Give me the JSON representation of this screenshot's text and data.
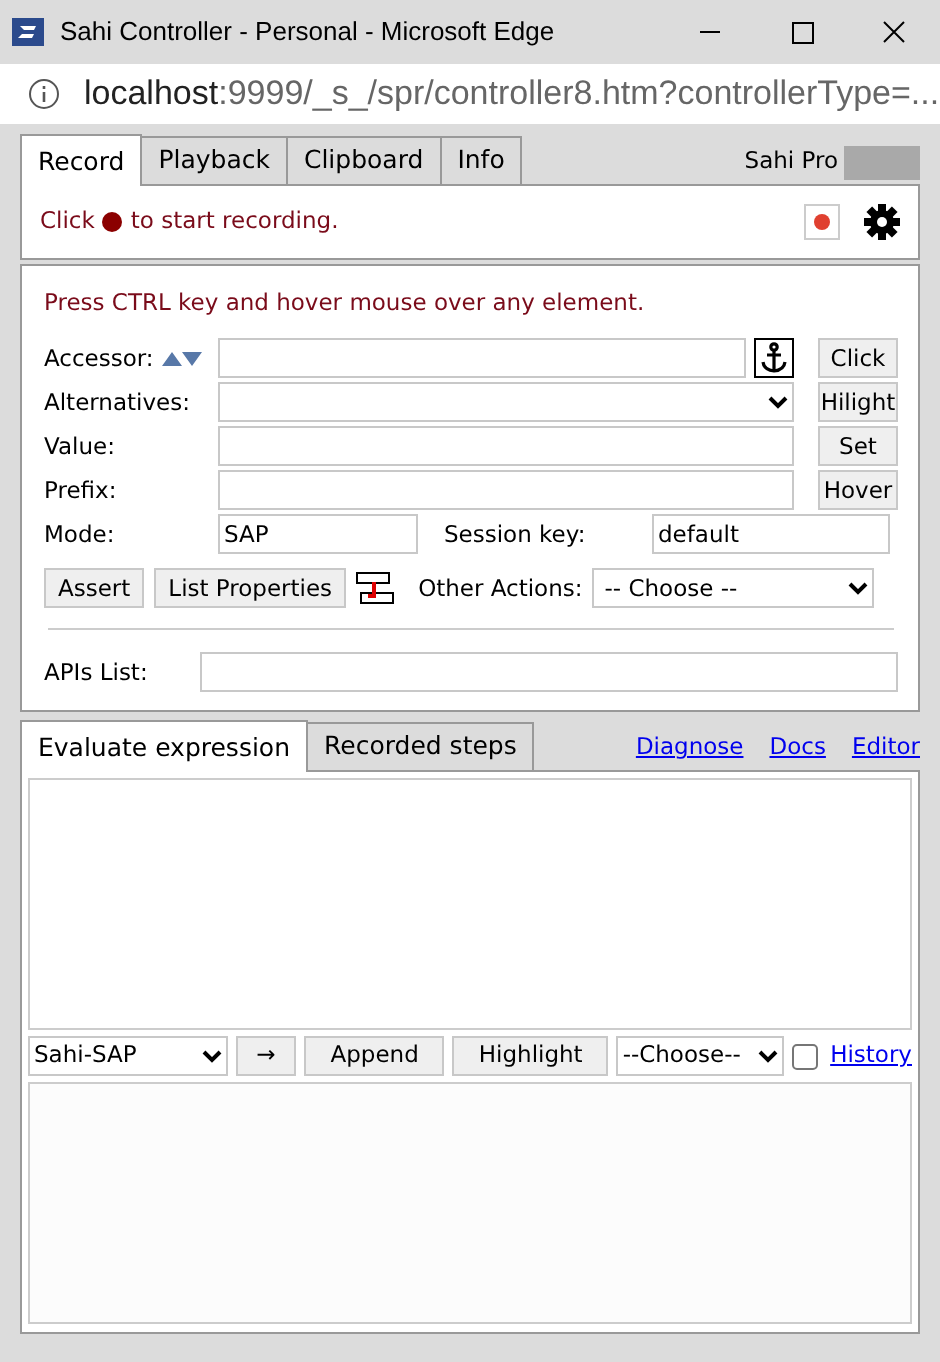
{
  "window": {
    "title": "Sahi Controller - Personal - Microsoft Edge"
  },
  "address_bar": {
    "host": "localhost",
    "path": ":9999/_s_/spr/controller8.htm?controllerType=..."
  },
  "tabs": [
    {
      "label": "Record",
      "selected": true
    },
    {
      "label": "Playback",
      "selected": false
    },
    {
      "label": "Clipboard",
      "selected": false
    },
    {
      "label": "Info",
      "selected": false
    }
  ],
  "brand": "Sahi Pro",
  "record_bar": {
    "text_before": "Click",
    "text_after": "to start recording."
  },
  "hint": "Press CTRL key and hover mouse over any element.",
  "rows": [
    {
      "label": "Accessor:",
      "kind": "input",
      "button": "Click"
    },
    {
      "label": "Alternatives:",
      "kind": "select",
      "button": "Hilight"
    },
    {
      "label": "Value:",
      "kind": "input",
      "button": "Set"
    },
    {
      "label": "Prefix:",
      "kind": "input",
      "button": "Hover"
    }
  ],
  "mode": {
    "label": "Mode:",
    "value": "SAP"
  },
  "session_key": {
    "label": "Session key:",
    "value": "default"
  },
  "action_buttons": [
    "Assert",
    "List Properties"
  ],
  "other_actions": {
    "label": "Other Actions:",
    "value": "-- Choose --"
  },
  "apis_list": {
    "label": "APIs List:"
  },
  "lower_tabs": [
    {
      "label": "Evaluate expression",
      "selected": true
    },
    {
      "label": "Recorded steps",
      "selected": false
    }
  ],
  "links": [
    "Diagnose",
    "Docs",
    "Editor"
  ],
  "toolbar": {
    "mode_select": "Sahi-SAP",
    "arrow_button": "→",
    "buttons": [
      "Append",
      "Highlight"
    ],
    "choose_select": "--Choose--",
    "history": {
      "label": "History",
      "checked": false
    }
  }
}
